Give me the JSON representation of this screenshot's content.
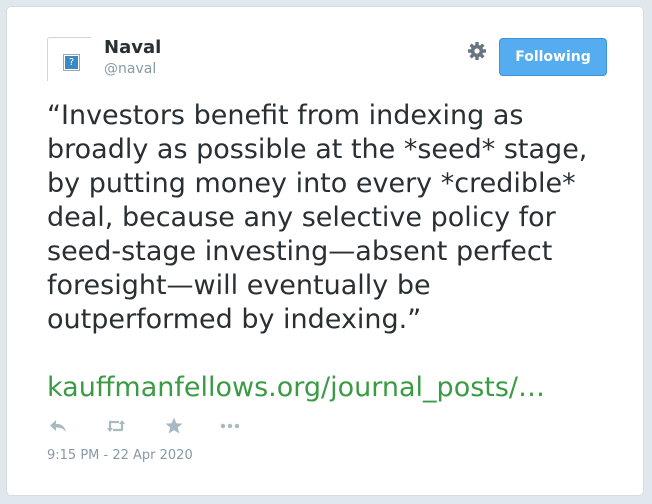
{
  "author": {
    "name": "Naval",
    "handle": "@naval",
    "avatar_icon": "broken-image-icon",
    "avatar_glyph": "?"
  },
  "follow_button": {
    "label": "Following",
    "color": "#55acee"
  },
  "settings_icon": "gear-icon",
  "tweet": {
    "text": "“Investors benefit from indexing as broadly as possible at the *seed* stage, by putting money into every *credible* deal, because any selective policy for seed-stage investing—absent perfect foresight—will eventually be outperformed by indexing.”",
    "link": "kauffmanfellows.org/journal_posts/…",
    "link_color": "#3b9b45",
    "timestamp": "9:15 PM - 22 Apr 2020"
  },
  "actions": [
    {
      "name": "reply",
      "icon": "reply-icon"
    },
    {
      "name": "retweet",
      "icon": "retweet-icon"
    },
    {
      "name": "favorite",
      "icon": "star-icon"
    },
    {
      "name": "more",
      "icon": "more-dots-icon"
    }
  ],
  "colors": {
    "text": "#292f33",
    "muted": "#8899a6",
    "icon": "#aab8c2"
  }
}
